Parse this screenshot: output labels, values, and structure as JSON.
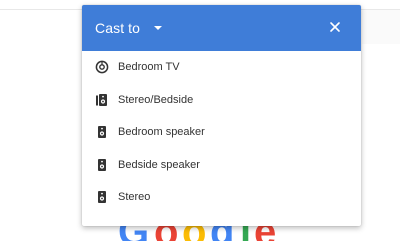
{
  "cast_dialog": {
    "title": "Cast to",
    "close_label": "×",
    "header_color": "#3f7dd8",
    "devices": [
      {
        "label": "Bedroom TV",
        "icon": "chromecast-icon"
      },
      {
        "label": "Stereo/Bedside",
        "icon": "speaker-group-icon"
      },
      {
        "label": "Bedroom speaker",
        "icon": "speaker-icon"
      },
      {
        "label": "Bedside speaker",
        "icon": "speaker-icon"
      },
      {
        "label": "Stereo",
        "icon": "speaker-icon"
      }
    ]
  },
  "background": {
    "logo_letters": [
      "G",
      "o",
      "o",
      "g",
      "l",
      "e"
    ],
    "logo_colors": [
      "#4285f4",
      "#ea4335",
      "#fbbc05",
      "#4285f4",
      "#34a853",
      "#ea4335"
    ]
  }
}
